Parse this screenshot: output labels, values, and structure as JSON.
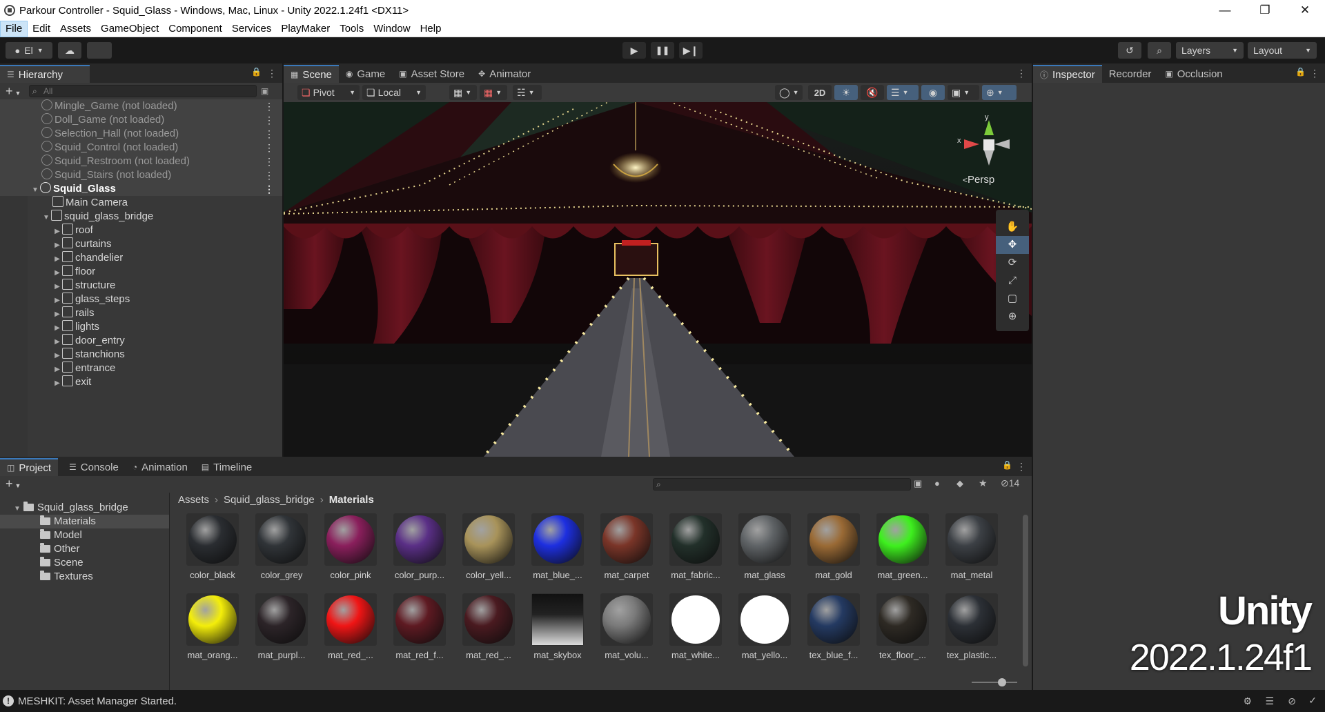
{
  "window": {
    "title": "Parkour Controller - Squid_Glass - Windows, Mac, Linux - Unity 2022.1.24f1 <DX11>",
    "minimize": "—",
    "maximize": "❐",
    "close": "✕"
  },
  "menu": [
    "File",
    "Edit",
    "Assets",
    "GameObject",
    "Component",
    "Services",
    "PlayMaker",
    "Tools",
    "Window",
    "Help"
  ],
  "toolbar": {
    "account_label": "El",
    "layers_label": "Layers",
    "layout_label": "Layout"
  },
  "hierarchy": {
    "tab_label": "Hierarchy",
    "search_placeholder": "All",
    "scenes_unloaded": [
      "Mingle_Game (not loaded)",
      "Doll_Game (not loaded)",
      "Selection_Hall (not loaded)",
      "Squid_Control (not loaded)",
      "Squid_Restroom (not loaded)",
      "Squid_Stairs (not loaded)"
    ],
    "active_scene": "Squid_Glass",
    "main_camera": "Main Camera",
    "root_object": "squid_glass_bridge",
    "children": [
      "roof",
      "curtains",
      "chandelier",
      "floor",
      "structure",
      "glass_steps",
      "rails",
      "lights",
      "door_entry",
      "stanchions",
      "entrance",
      "exit"
    ]
  },
  "scene_tabs": [
    "Scene",
    "Game",
    "Asset Store",
    "Animator"
  ],
  "scene_toolbar": {
    "pivot": "Pivot",
    "local": "Local",
    "mode_2d": "2D",
    "persp": "Persp",
    "gizmo_y": "y",
    "gizmo_x": "x"
  },
  "inspector_tabs": [
    "Inspector",
    "Recorder",
    "Occlusion"
  ],
  "project": {
    "tabs": [
      "Project",
      "Console",
      "Animation",
      "Timeline"
    ],
    "hidden_count": "14",
    "folder_root": "Squid_glass_bridge",
    "folders": [
      "Materials",
      "Model",
      "Other",
      "Scene",
      "Textures"
    ],
    "breadcrumb": [
      "Assets",
      "Squid_glass_bridge",
      "Materials"
    ],
    "assets": [
      {
        "label": "color_black",
        "color": "#2a2d31"
      },
      {
        "label": "color_grey",
        "color": "#303438"
      },
      {
        "label": "color_pink",
        "color": "#8a1f5c"
      },
      {
        "label": "color_purp...",
        "color": "#5a2f86"
      },
      {
        "label": "color_yell...",
        "color": "#a8935a"
      },
      {
        "label": "mat_blue_...",
        "color": "#1d2fe0"
      },
      {
        "label": "mat_carpet",
        "color": "#7a3528"
      },
      {
        "label": "mat_fabric...",
        "color": "#22302a"
      },
      {
        "label": "mat_glass",
        "color": "#5f6366"
      },
      {
        "label": "mat_gold",
        "color": "#9a6a35"
      },
      {
        "label": "mat_green...",
        "color": "#3ef01e"
      },
      {
        "label": "mat_metal",
        "color": "#3c4045"
      },
      {
        "label": "mat_orang...",
        "color": "#f4ee0a"
      },
      {
        "label": "mat_purpl...",
        "color": "#2c2428"
      },
      {
        "label": "mat_red_...",
        "color": "#f01515"
      },
      {
        "label": "mat_red_f...",
        "color": "#5e1a22"
      },
      {
        "label": "mat_red_...",
        "color": "#4a1a20"
      },
      {
        "label": "mat_skybox",
        "color": "skybox"
      },
      {
        "label": "mat_volu...",
        "color": "#7a7a7a"
      },
      {
        "label": "mat_white...",
        "color": "#ffffff"
      },
      {
        "label": "mat_yello...",
        "color": "#ffffff"
      },
      {
        "label": "tex_blue_f...",
        "color": "#243a62"
      },
      {
        "label": "tex_floor_...",
        "color": "#2e2a24"
      },
      {
        "label": "tex_plastic...",
        "color": "#2c3036"
      }
    ]
  },
  "status": "MESHKIT: Asset Manager Started.",
  "watermark": {
    "line1": "Unity",
    "line2": "2022.1.24f1"
  }
}
